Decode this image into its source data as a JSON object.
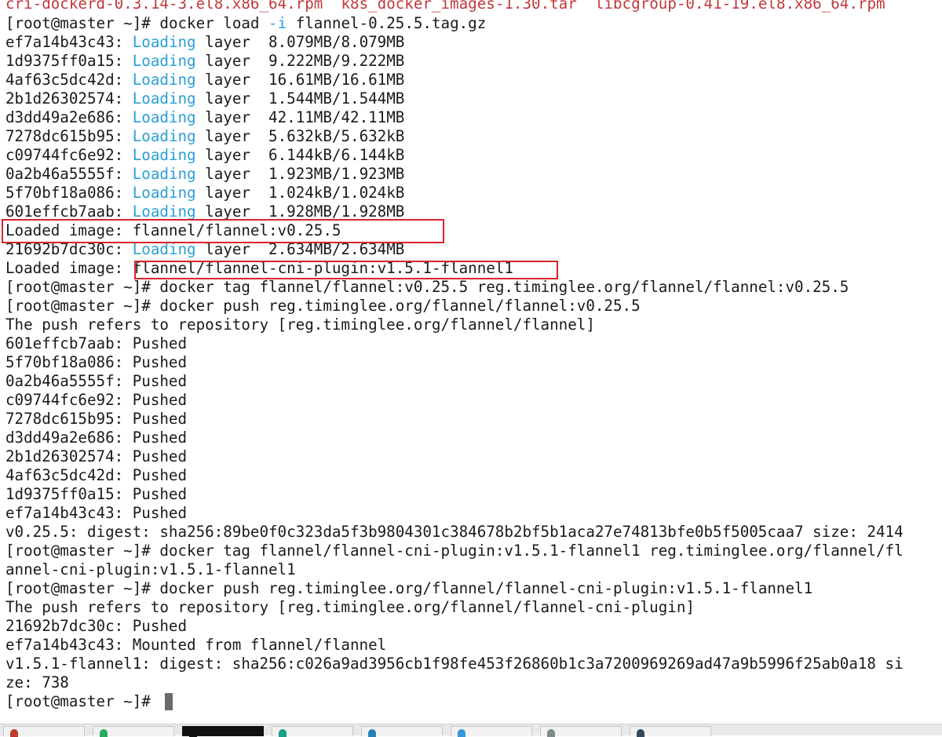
{
  "terminal": {
    "top_files": [
      "cri-dockerd-0.3.14-3.el8.x86_64.rpm",
      "k8s_docker_images-1.30.tar",
      "libcgroup-0.41-19.el8.x86_64.rpm"
    ],
    "prompt": "[root@master ~]#",
    "load_cmd": "docker load ",
    "load_opt": "-i",
    "load_arg": " flannel-0.25.5.tag.gz",
    "loading_word": "Loading",
    "layer_word": " layer  ",
    "loading_layers": [
      {
        "id": "ef7a14b43c43:",
        "size": "8.079MB/8.079MB"
      },
      {
        "id": "1d9375ff0a15:",
        "size": "9.222MB/9.222MB"
      },
      {
        "id": "4af63c5dc42d:",
        "size": "16.61MB/16.61MB"
      },
      {
        "id": "2b1d26302574:",
        "size": "1.544MB/1.544MB"
      },
      {
        "id": "d3dd49a2e686:",
        "size": "42.11MB/42.11MB"
      },
      {
        "id": "7278dc615b95:",
        "size": "5.632kB/5.632kB"
      },
      {
        "id": "c09744fc6e92:",
        "size": "6.144kB/6.144kB"
      },
      {
        "id": "0a2b46a5555f:",
        "size": "1.923MB/1.923MB"
      },
      {
        "id": "5f70bf18a086:",
        "size": "1.024kB/1.024kB"
      },
      {
        "id": "601effcb7aab:",
        "size": "1.928MB/1.928MB"
      }
    ],
    "loaded_image_1": "Loaded image: flannel/flannel:v0.25.5",
    "cni_layer": {
      "id": "21692b7dc30c:",
      "size": "2.634MB/2.634MB"
    },
    "loaded_image_2_prefix": "Loaded image: ",
    "loaded_image_2_value": "flannel/flannel-cni-plugin:v1.5.1-flannel1",
    "tag_cmd_1": " docker tag flannel/flannel:v0.25.5 reg.timinglee.org/flannel/flannel:v0.25.5",
    "push_cmd_1": " docker push reg.timinglee.org/flannel/flannel:v0.25.5",
    "push_refers_1": "The push refers to repository [reg.timinglee.org/flannel/flannel]",
    "pushed_layers": [
      "601effcb7aab: Pushed",
      "5f70bf18a086: Pushed",
      "0a2b46a5555f: Pushed",
      "c09744fc6e92: Pushed",
      "7278dc615b95: Pushed",
      "d3dd49a2e686: Pushed",
      "2b1d26302574: Pushed",
      "4af63c5dc42d: Pushed",
      "1d9375ff0a15: Pushed",
      "ef7a14b43c43: Pushed"
    ],
    "digest_1": "v0.25.5: digest: sha256:89be0f0c323da5f3b9804301c384678b2bf5b1aca27e74813bfe0b5f5005caa7 size: 2414",
    "tag_cmd_2a": " docker tag flannel/flannel-cni-plugin:v1.5.1-flannel1 reg.timinglee.org/flannel/fl",
    "tag_cmd_2b": "annel-cni-plugin:v1.5.1-flannel1",
    "push_cmd_2": " docker push reg.timinglee.org/flannel/flannel-cni-plugin:v1.5.1-flannel1",
    "push_refers_2": "The push refers to repository [reg.timinglee.org/flannel/flannel-cni-plugin]",
    "pushed_2a": "21692b7dc30c: Pushed",
    "mounted_2b": "ef7a14b43c43: Mounted from flannel/flannel",
    "digest_2a": "v1.5.1-flannel1: digest: sha256:c026a9ad3956cb1f98fe453f26860b1c3a7200969269ad47a9b5996f25ab0a18 si",
    "digest_2b": "ze: 738",
    "final_prompt": "[root@master ~]# "
  },
  "colors": {
    "file_red": "#c0393b",
    "loading_blue": "#2a9fd6",
    "highlight_box": "#d8252b",
    "cursor_gray": "#6b6b6b"
  },
  "taskbar": {
    "items": [
      {
        "icon": "app-icon-red",
        "color": "#c0392b"
      },
      {
        "icon": "app-icon-green",
        "color": "#27ae60"
      },
      {
        "icon": "terminal-icon",
        "color": "#111111"
      },
      {
        "icon": "app-icon-teal",
        "color": "#16a085"
      },
      {
        "icon": "app-icon-blue",
        "color": "#2980b9"
      },
      {
        "icon": "app-icon-sky",
        "color": "#3498db"
      },
      {
        "icon": "app-icon-gray",
        "color": "#7f8c8d"
      },
      {
        "icon": "app-icon-slate",
        "color": "#34495e"
      }
    ]
  }
}
